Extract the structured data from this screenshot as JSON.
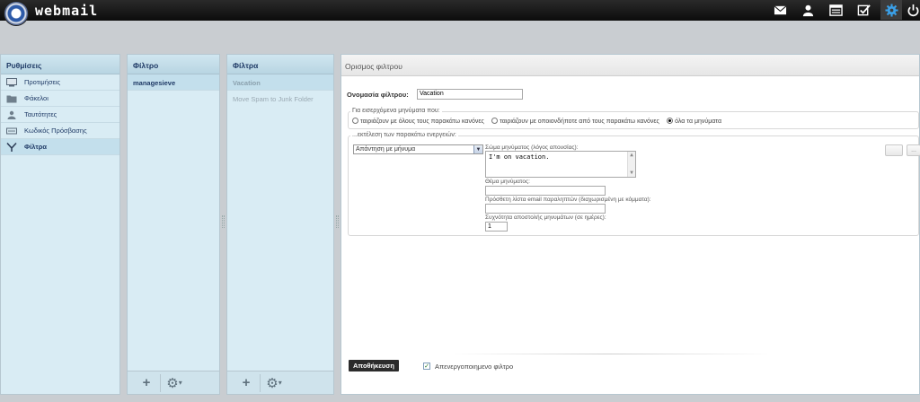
{
  "app": {
    "brand": "webmail"
  },
  "topbar": {
    "icons": [
      "mail-icon",
      "user-icon",
      "addressbook-icon",
      "tasks-icon",
      "settings-icon",
      "power-icon"
    ],
    "active": "settings-icon"
  },
  "settings_panel": {
    "title": "Ρυθμίσεις",
    "items": [
      {
        "label": "Προτιμήσεις",
        "icon": "monitor-icon"
      },
      {
        "label": "Φάκελοι",
        "icon": "folder-icon"
      },
      {
        "label": "Ταυτότητες",
        "icon": "user-icon"
      },
      {
        "label": "Κωδικός Πρόσβασης",
        "icon": "key-icon"
      },
      {
        "label": "Φίλτρα",
        "icon": "filter-icon",
        "selected": true
      }
    ]
  },
  "filterset_panel": {
    "title": "Φίλτρο",
    "items": [
      {
        "label": "managesieve",
        "selected": true
      }
    ]
  },
  "filters_panel": {
    "title": "Φίλτρα",
    "items": [
      {
        "label": "Vacation",
        "selected": true
      },
      {
        "label": "Move Spam to Junk Folder"
      }
    ]
  },
  "footer_buttons": {
    "add": "+",
    "gear": "⚙",
    "dropdown": "▾"
  },
  "form": {
    "title": "Ορισμος φιλτρου",
    "name_label": "Ονομασία φίλτρου:",
    "name_value": "Vacation",
    "rules_legend": "Για εισερχόμενα μηνύματα που:",
    "match_options": [
      {
        "label": "ταιριάζουν με όλους τους παρακάτω κανόνες",
        "checked": false
      },
      {
        "label": "ταιριάζουν με οποιονδήποτε από τους παρακάτω κανόνες",
        "checked": false
      },
      {
        "label": "όλα τα μηνύματα",
        "checked": true
      }
    ],
    "actions_legend": "...εκτέλεση των παρακάτω ενεργειών:",
    "action_select": "Απάντηση με μήνυμα",
    "body_label": "Σώμα μηνύματος (λόγος απουσίας):",
    "body_value": "I'm on vacation.",
    "subject_label": "Θέμα μηνύματος:",
    "subject_value": "",
    "addresses_label": "Πρόσθετη λίστα email παραληπτών (διαχωρισμένη με κόμματα):",
    "addresses_value": "",
    "days_label": "Συχνότητα αποστολής μηνυμάτων (σε ημέρες):",
    "days_value": "1",
    "side_buttons": [
      "",
      "..."
    ],
    "save_label": "Αποθήκευση",
    "disabled_label": "Απενεργοποιημενο φιλτρο",
    "disabled_checked": true
  }
}
